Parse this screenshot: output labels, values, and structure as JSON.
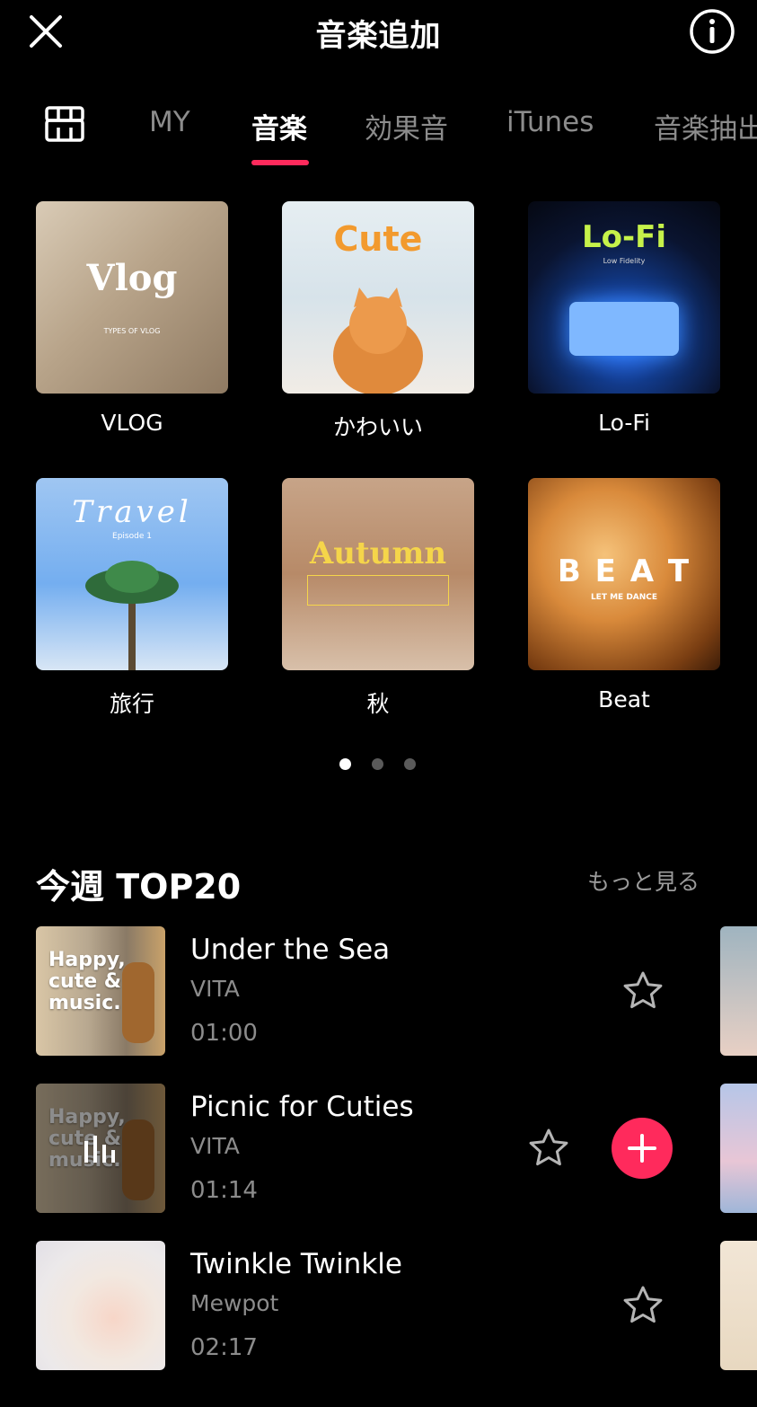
{
  "header": {
    "title": "音楽追加"
  },
  "tabs": [
    {
      "label": "MY"
    },
    {
      "label": "音楽"
    },
    {
      "label": "効果音"
    },
    {
      "label": "iTunes"
    },
    {
      "label": "音楽抽出"
    }
  ],
  "categories": [
    {
      "label": "VLOG",
      "cover_text": "Vlog",
      "cover_sub": "TYPES OF VLOG"
    },
    {
      "label": "かわいい",
      "cover_text": "Cute"
    },
    {
      "label": "Lo-Fi",
      "cover_text": "Lo-Fi",
      "cover_sub": "Low Fidelity"
    },
    {
      "label": "旅行",
      "cover_text": "Travel",
      "cover_sub": "Episode 1"
    },
    {
      "label": "秋",
      "cover_text": "Autumn"
    },
    {
      "label": "Beat",
      "cover_text": "B E A T",
      "cover_sub": "LET ME DANCE"
    }
  ],
  "pager": {
    "count": 3,
    "active": 0
  },
  "section": {
    "title": "今週 TOP20",
    "see_more": "もっと見る"
  },
  "songs": [
    {
      "title": "Under the Sea",
      "artist": "VITA",
      "duration": "01:00",
      "cover_text": "Happy, cute & music."
    },
    {
      "title": "Picnic for Cuties",
      "artist": "VITA",
      "duration": "01:14",
      "cover_text": "Happy, cute & music.",
      "playing": true
    },
    {
      "title": "Twinkle Twinkle",
      "artist": "Mewpot",
      "duration": "02:17"
    }
  ],
  "colors": {
    "accent": "#ff2a5c",
    "inactive_text": "#8c8c8c",
    "background": "#000000"
  }
}
